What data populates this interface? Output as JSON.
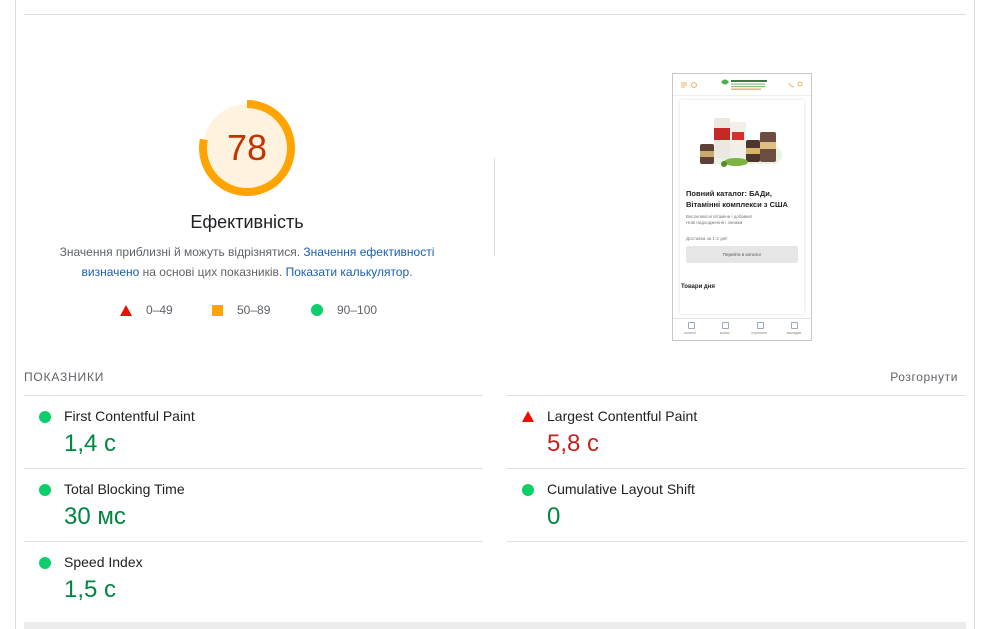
{
  "gauge": {
    "score": "78",
    "score_fraction": 0.78,
    "title": "Ефективність",
    "desc_text_1": "Значення приблизні й можуть відрізнятися. ",
    "desc_link_1": "Значення ефективності визначено",
    "desc_text_2": " на основі цих показників. ",
    "desc_link_2": "Показати калькулятор",
    "desc_text_3": ".",
    "color_fail": "#eb0f00",
    "color_average": "#ffa400",
    "color_pass": "#0cce6b"
  },
  "legend": {
    "fail": "0–49",
    "average": "50–89",
    "pass": "90–100"
  },
  "screenshot": {
    "title": "Повний каталог: БАДи, Вітамінні комплекси з США",
    "subtitle_1": "Високоякісні вітаміни і добавки!",
    "subtitle_2": "Нові надходження і знижки",
    "delivery": "Доставка за 1-2 дні!",
    "button": "Перейти в каталог",
    "section": "Товари дня",
    "nav": [
      "каталог",
      "кошик",
      "порівняти",
      "закладки"
    ]
  },
  "metrics": {
    "header": "ПОКАЗНИКИ",
    "expand": "Розгорнути",
    "fcp": {
      "label": "First Contentful Paint",
      "value": "1,4 с",
      "status": "pass"
    },
    "lcp": {
      "label": "Largest Contentful Paint",
      "value": "5,8 с",
      "status": "fail"
    },
    "tbt": {
      "label": "Total Blocking Time",
      "value": "30 мс",
      "status": "pass"
    },
    "cls": {
      "label": "Cumulative Layout Shift",
      "value": "0",
      "status": "pass"
    },
    "si": {
      "label": "Speed Index",
      "value": "1,5 с",
      "status": "pass"
    }
  }
}
